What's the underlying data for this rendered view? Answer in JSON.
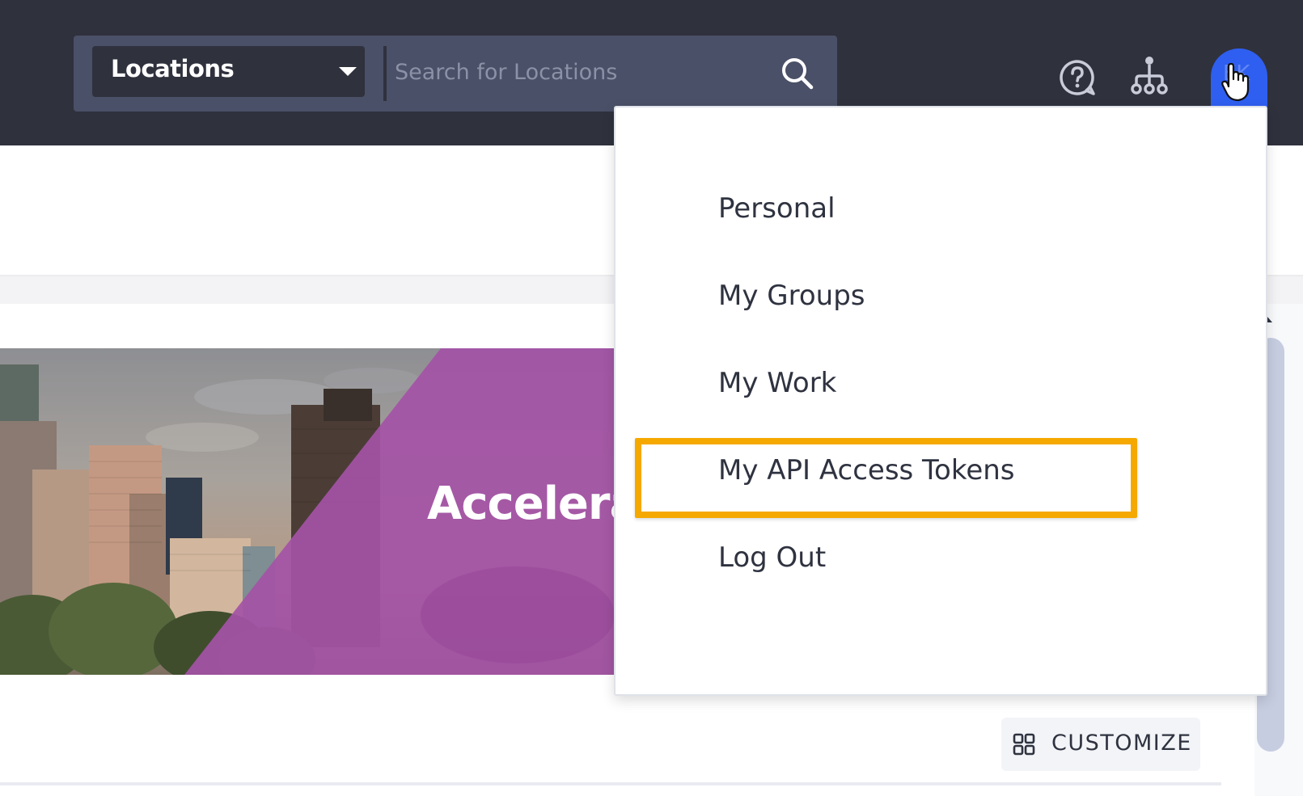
{
  "header": {
    "scope_select": {
      "value": "Locations",
      "icon": "caret-down-icon"
    },
    "search": {
      "placeholder": "Search for Locations",
      "icon": "search-icon"
    },
    "help_icon": "help-bubble-icon",
    "hierarchy_icon": "org-hierarchy-icon",
    "avatar": {
      "initials": "EK",
      "color": "#2f5ff0"
    }
  },
  "hero": {
    "title": "Accelerat"
  },
  "user_menu": {
    "items": [
      {
        "label": "Personal"
      },
      {
        "label": "My Groups"
      },
      {
        "label": "My Work"
      },
      {
        "label": "My API Access Tokens",
        "highlighted": true
      },
      {
        "label": "Log Out"
      }
    ],
    "highlight_color": "#f5a800"
  },
  "toolbar": {
    "customize_label": "CUSTOMIZE",
    "customize_icon": "grid-icon"
  },
  "colors": {
    "topbar": "#2f313d",
    "search_group": "#4a5067",
    "hero_purple": "#a452a6",
    "accent_blue": "#2f5ff0"
  }
}
